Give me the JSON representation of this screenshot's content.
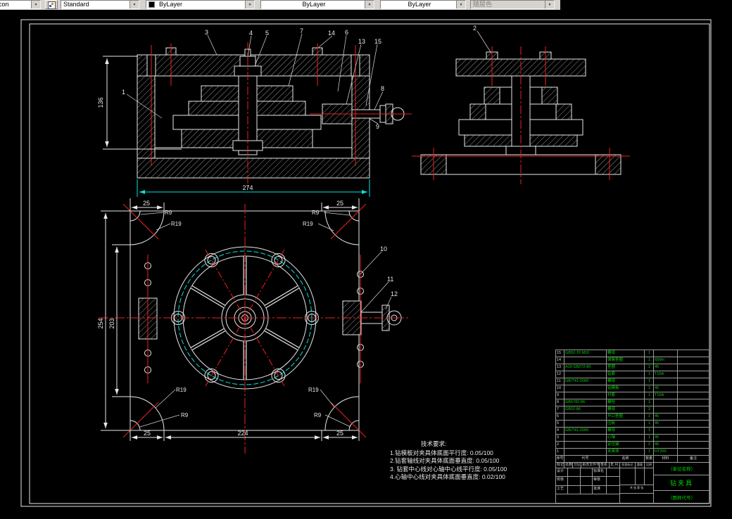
{
  "toolbar": {
    "layer_partial": "con",
    "style": "Standard",
    "color": "ByLayer",
    "linetype": "ByLayer",
    "lineweight": "ByLayer",
    "plot_style": "随层色"
  },
  "colors": {
    "centerline_red": "#ee2020",
    "dimension_cyan": "#00e5e5",
    "bom_green": "#00d400",
    "line_white": "#e8e8e8",
    "toolbar_gray": "#d6d3ce"
  },
  "callouts": {
    "c1": "1",
    "c2": "2",
    "c3": "3",
    "c4": "4",
    "c5": "5",
    "c6": "6",
    "c7": "7",
    "c8": "8",
    "c9": "9",
    "c10": "10",
    "c11": "11",
    "c12": "12",
    "c13": "13",
    "c14": "14",
    "c15": "15"
  },
  "dims": {
    "front_height": "136",
    "front_width": "274",
    "plan_outer_height": "254",
    "plan_inner_height": "203",
    "plan_top_left": "25",
    "plan_top_right": "25",
    "plan_bottom_left": "25",
    "plan_bottom_middle": "224",
    "plan_bottom_right": "25"
  },
  "radius_labels": {
    "tl_small": "R9",
    "tl_large": "R19",
    "tr_small": "R9",
    "tr_large": "R19",
    "bl_large": "R19",
    "bl_small": "R9",
    "br_large": "R19",
    "br_small": "R9"
  },
  "tech_requirements": {
    "title": "技术要求:",
    "items": [
      "1.钻模板对夹具体底面平行度: 0.05/100",
      "2.钻套轴线对夹具体底面垂直度: 0.05/100",
      "3. 钻套中心线对心轴中心线平行度: 0.05/100",
      "4.心轴中心线对夹具体底面垂直度: 0.02/100"
    ]
  },
  "bom": {
    "headers": [
      "序号",
      "代号",
      "名称",
      "数量",
      "材料",
      "备注"
    ],
    "rows": [
      {
        "seq": "15",
        "code": "GB52-76 M10",
        "name": "螺母",
        "qty": "1",
        "material": "",
        "note": ""
      },
      {
        "seq": "14",
        "code": "",
        "name": "弹簧垫圈",
        "qty": "1",
        "material": "65Mn",
        "note": ""
      },
      {
        "seq": "13",
        "code": "A10 GB272-80",
        "name": "垫圈",
        "qty": "1",
        "material": "45",
        "note": ""
      },
      {
        "seq": "12",
        "code": "",
        "name": "钻套",
        "qty": "1",
        "material": "T10A",
        "note": ""
      },
      {
        "seq": "11",
        "code": "GB/T41-2000",
        "name": "螺母",
        "qty": "1",
        "material": "",
        "note": ""
      },
      {
        "seq": "10",
        "code": "",
        "name": "钻模板",
        "qty": "1",
        "material": "45",
        "note": ""
      },
      {
        "seq": "9",
        "code": "",
        "name": "衬套",
        "qty": "1",
        "material": "T10A",
        "note": ""
      },
      {
        "seq": "8",
        "code": "GB5782-86",
        "name": "螺栓",
        "qty": "1",
        "material": "",
        "note": ""
      },
      {
        "seq": "7",
        "code": "GB52-86",
        "name": "螺母",
        "qty": "2",
        "material": "",
        "note": ""
      },
      {
        "seq": "6",
        "code": "",
        "name": "开口垫圈",
        "qty": "1",
        "material": "45",
        "note": ""
      },
      {
        "seq": "5",
        "code": "",
        "name": "压板",
        "qty": "1",
        "material": "45",
        "note": ""
      },
      {
        "seq": "4",
        "code": "GB/T41-2000",
        "name": "螺母",
        "qty": "1",
        "material": "",
        "note": ""
      },
      {
        "seq": "3",
        "code": "",
        "name": "心轴",
        "qty": "1",
        "material": "45",
        "note": ""
      },
      {
        "seq": "2",
        "code": "",
        "name": "定位键",
        "qty": "2",
        "material": "45",
        "note": ""
      },
      {
        "seq": "1",
        "code": "",
        "name": "夹具体",
        "qty": "1",
        "material": "HT200",
        "note": ""
      }
    ]
  },
  "title_block": {
    "unit_name": "（单位名称）",
    "drawing_title": "钻夹具",
    "drawing_code": "（图样代号）",
    "row_a": [
      "标记",
      "处数",
      "分区",
      "更改文件号",
      "签名",
      "年.月.日"
    ],
    "sign_rows": [
      [
        "设计",
        "标准化"
      ],
      [
        "校核",
        "审核"
      ],
      [
        "工艺",
        "批准"
      ]
    ],
    "mid_labels": [
      "阶段标记",
      "重量",
      "比例"
    ],
    "sheet_label": "共 张 第 张"
  }
}
